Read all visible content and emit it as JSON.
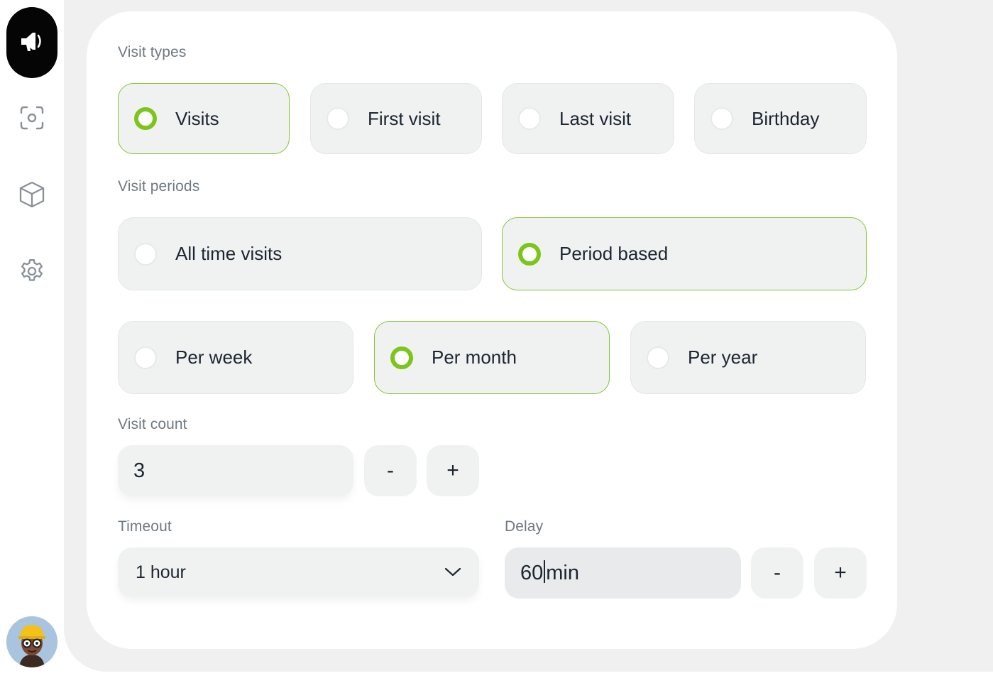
{
  "sidebar": {
    "items": [
      {
        "icon": "megaphone-icon",
        "active": true
      },
      {
        "icon": "scan-icon",
        "active": false
      },
      {
        "icon": "box-icon",
        "active": false
      },
      {
        "icon": "gear-icon",
        "active": false
      }
    ],
    "avatar": "user-avatar"
  },
  "visit_types": {
    "label": "Visit types",
    "options": [
      {
        "label": "Visits",
        "selected": true
      },
      {
        "label": "First visit",
        "selected": false
      },
      {
        "label": "Last visit",
        "selected": false
      },
      {
        "label": "Birthday",
        "selected": false
      }
    ]
  },
  "visit_periods": {
    "label": "Visit periods",
    "options": [
      {
        "label": "All time visits",
        "selected": false
      },
      {
        "label": "Period based",
        "selected": true
      }
    ],
    "sub_options": [
      {
        "label": "Per week",
        "selected": false
      },
      {
        "label": "Per month",
        "selected": true
      },
      {
        "label": "Per year",
        "selected": false
      }
    ]
  },
  "visit_count": {
    "label": "Visit count",
    "value": "3",
    "minus": "-",
    "plus": "+"
  },
  "timeout": {
    "label": "Timeout",
    "value": "1 hour"
  },
  "delay": {
    "label": "Delay",
    "value": "60",
    "unit": "min",
    "minus": "-",
    "plus": "+"
  },
  "colors": {
    "accent": "#7cc51a",
    "option_bg": "#f0f2f2",
    "page_bg": "#f0f0f0"
  }
}
